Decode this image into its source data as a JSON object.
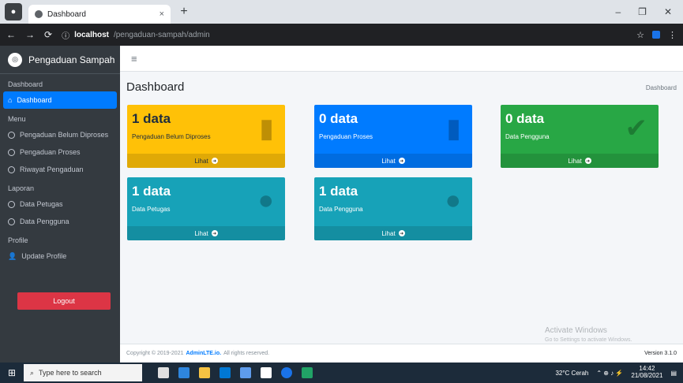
{
  "browser": {
    "tab_title": "Dashboard",
    "tab_close": "×",
    "new_tab": "+",
    "window_controls": [
      "–",
      "❐",
      "✕"
    ],
    "url_host": "localhost",
    "url_path": "/pengaduan-sampah/admin",
    "nav_back": "←",
    "nav_forward": "→",
    "nav_reload": "⟳",
    "addr_right": [
      "☆",
      "⋮"
    ]
  },
  "sidebar": {
    "brand": "Pengaduan Sampah",
    "header_dashboard": "Dashboard",
    "items": [
      {
        "label": "Dashboard",
        "icon": "home-icon",
        "active": true
      }
    ],
    "header_menu": "Menu",
    "menu_items": [
      {
        "label": "Pengaduan Belum Diproses"
      },
      {
        "label": "Pengaduan Proses"
      },
      {
        "label": "Riwayat Pengaduan"
      }
    ],
    "header_laporan": "Laporan",
    "laporan_items": [
      {
        "label": "Data Petugas"
      },
      {
        "label": "Data Pengguna"
      }
    ],
    "header_profile": "Profile",
    "profile_item": "Update Profile",
    "logout": "Logout"
  },
  "navbar": {
    "hamburger": "≡"
  },
  "page": {
    "title": "Dashboard",
    "breadcrumb": "Dashboard"
  },
  "cards": [
    {
      "value": "1 data",
      "label": "Pengaduan Belum Diproses",
      "footer": "Lihat",
      "color": "#ffc107"
    },
    {
      "value": "0 data",
      "label": "Pengaduan Proses",
      "footer": "Lihat",
      "color": "#007bff"
    },
    {
      "value": "0 data",
      "label": "Data Pengguna",
      "footer": "Lihat",
      "color": "#28a745"
    },
    {
      "value": "1 data",
      "label": "Data Petugas",
      "footer": "Lihat",
      "color": "#17a2b8"
    },
    {
      "value": "1 data",
      "label": "Data Pengguna",
      "footer": "Lihat",
      "color": "#17a2b8"
    }
  ],
  "footer": {
    "copyright": "Copyright © 2019-2021",
    "link": "AdminLTE.io.",
    "rights": "All rights reserved.",
    "version": "Version 3.1.0"
  },
  "watermark": {
    "line1": "Activate Windows",
    "line2": "Go to Settings to activate Windows."
  },
  "taskbar": {
    "search_placeholder": "Type here to search",
    "weather": "32°C Cerah",
    "time": "14:42",
    "date": "21/08/2021"
  }
}
